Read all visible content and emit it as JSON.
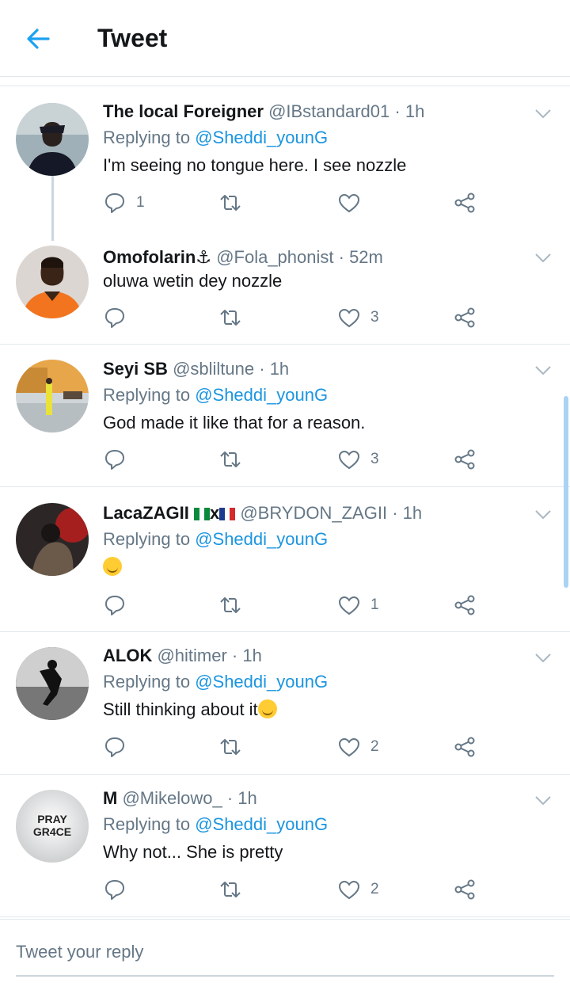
{
  "header": {
    "title": "Tweet",
    "back_icon": "arrow-left-icon",
    "accent": "#1da1f2"
  },
  "tweets": [
    {
      "name": "The local Foreigner",
      "handle": "@IBstandard01",
      "time": "· 1h",
      "replying_prefix": "Replying to ",
      "replying_to": "@Sheddi_younG",
      "text": "I'm seeing no tongue here. I see nozzle",
      "replies": "1",
      "retweets": "",
      "likes": ""
    },
    {
      "name": "Omofolarin⚓",
      "handle": "@Fola_phonist",
      "time": "· 52m",
      "text": "oluwa wetin dey nozzle",
      "replies": "",
      "retweets": "",
      "likes": "3"
    },
    {
      "name": "Seyi SB",
      "handle": "@sbliltune",
      "time": "· 1h",
      "replying_prefix": "Replying to ",
      "replying_to": "@Sheddi_younG",
      "text": "God made it like that for a reason.",
      "replies": "",
      "retweets": "",
      "likes": "3"
    },
    {
      "name": "LacaZAGII",
      "name_suffix": "x",
      "handle": "@BRYDON_ZAGII",
      "time": "· 1h",
      "replying_prefix": "Replying to ",
      "replying_to": "@Sheddi_younG",
      "text": "",
      "replies": "",
      "retweets": "",
      "likes": "1"
    },
    {
      "name": "ALOK",
      "handle": "@hitimer",
      "time": "· 1h",
      "replying_prefix": "Replying to ",
      "replying_to": "@Sheddi_younG",
      "text": "Still thinking about it",
      "replies": "",
      "retweets": "",
      "likes": "2"
    },
    {
      "name": "M",
      "handle": "@Mikelowo_",
      "time": "· 1h",
      "replying_prefix": "Replying to ",
      "replying_to": "@Sheddi_younG",
      "text": "Why not... She is pretty",
      "replies": "",
      "retweets": "",
      "likes": "2",
      "avatar_text_top": "PRAY",
      "avatar_text_bottom": "GR4CE"
    }
  ],
  "compose": {
    "placeholder": "Tweet your reply"
  }
}
